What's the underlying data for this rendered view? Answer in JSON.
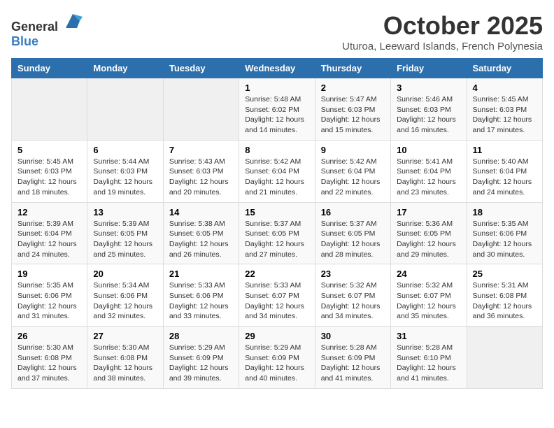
{
  "header": {
    "logo_general": "General",
    "logo_blue": "Blue",
    "month_title": "October 2025",
    "location": "Uturoa, Leeward Islands, French Polynesia"
  },
  "days_of_week": [
    "Sunday",
    "Monday",
    "Tuesday",
    "Wednesday",
    "Thursday",
    "Friday",
    "Saturday"
  ],
  "weeks": [
    [
      {
        "day": "",
        "info": ""
      },
      {
        "day": "",
        "info": ""
      },
      {
        "day": "",
        "info": ""
      },
      {
        "day": "1",
        "sunrise": "Sunrise: 5:48 AM",
        "sunset": "Sunset: 6:02 PM",
        "daylight": "Daylight: 12 hours and 14 minutes."
      },
      {
        "day": "2",
        "sunrise": "Sunrise: 5:47 AM",
        "sunset": "Sunset: 6:03 PM",
        "daylight": "Daylight: 12 hours and 15 minutes."
      },
      {
        "day": "3",
        "sunrise": "Sunrise: 5:46 AM",
        "sunset": "Sunset: 6:03 PM",
        "daylight": "Daylight: 12 hours and 16 minutes."
      },
      {
        "day": "4",
        "sunrise": "Sunrise: 5:45 AM",
        "sunset": "Sunset: 6:03 PM",
        "daylight": "Daylight: 12 hours and 17 minutes."
      }
    ],
    [
      {
        "day": "5",
        "sunrise": "Sunrise: 5:45 AM",
        "sunset": "Sunset: 6:03 PM",
        "daylight": "Daylight: 12 hours and 18 minutes."
      },
      {
        "day": "6",
        "sunrise": "Sunrise: 5:44 AM",
        "sunset": "Sunset: 6:03 PM",
        "daylight": "Daylight: 12 hours and 19 minutes."
      },
      {
        "day": "7",
        "sunrise": "Sunrise: 5:43 AM",
        "sunset": "Sunset: 6:03 PM",
        "daylight": "Daylight: 12 hours and 20 minutes."
      },
      {
        "day": "8",
        "sunrise": "Sunrise: 5:42 AM",
        "sunset": "Sunset: 6:04 PM",
        "daylight": "Daylight: 12 hours and 21 minutes."
      },
      {
        "day": "9",
        "sunrise": "Sunrise: 5:42 AM",
        "sunset": "Sunset: 6:04 PM",
        "daylight": "Daylight: 12 hours and 22 minutes."
      },
      {
        "day": "10",
        "sunrise": "Sunrise: 5:41 AM",
        "sunset": "Sunset: 6:04 PM",
        "daylight": "Daylight: 12 hours and 23 minutes."
      },
      {
        "day": "11",
        "sunrise": "Sunrise: 5:40 AM",
        "sunset": "Sunset: 6:04 PM",
        "daylight": "Daylight: 12 hours and 24 minutes."
      }
    ],
    [
      {
        "day": "12",
        "sunrise": "Sunrise: 5:39 AM",
        "sunset": "Sunset: 6:04 PM",
        "daylight": "Daylight: 12 hours and 24 minutes."
      },
      {
        "day": "13",
        "sunrise": "Sunrise: 5:39 AM",
        "sunset": "Sunset: 6:05 PM",
        "daylight": "Daylight: 12 hours and 25 minutes."
      },
      {
        "day": "14",
        "sunrise": "Sunrise: 5:38 AM",
        "sunset": "Sunset: 6:05 PM",
        "daylight": "Daylight: 12 hours and 26 minutes."
      },
      {
        "day": "15",
        "sunrise": "Sunrise: 5:37 AM",
        "sunset": "Sunset: 6:05 PM",
        "daylight": "Daylight: 12 hours and 27 minutes."
      },
      {
        "day": "16",
        "sunrise": "Sunrise: 5:37 AM",
        "sunset": "Sunset: 6:05 PM",
        "daylight": "Daylight: 12 hours and 28 minutes."
      },
      {
        "day": "17",
        "sunrise": "Sunrise: 5:36 AM",
        "sunset": "Sunset: 6:05 PM",
        "daylight": "Daylight: 12 hours and 29 minutes."
      },
      {
        "day": "18",
        "sunrise": "Sunrise: 5:35 AM",
        "sunset": "Sunset: 6:06 PM",
        "daylight": "Daylight: 12 hours and 30 minutes."
      }
    ],
    [
      {
        "day": "19",
        "sunrise": "Sunrise: 5:35 AM",
        "sunset": "Sunset: 6:06 PM",
        "daylight": "Daylight: 12 hours and 31 minutes."
      },
      {
        "day": "20",
        "sunrise": "Sunrise: 5:34 AM",
        "sunset": "Sunset: 6:06 PM",
        "daylight": "Daylight: 12 hours and 32 minutes."
      },
      {
        "day": "21",
        "sunrise": "Sunrise: 5:33 AM",
        "sunset": "Sunset: 6:06 PM",
        "daylight": "Daylight: 12 hours and 33 minutes."
      },
      {
        "day": "22",
        "sunrise": "Sunrise: 5:33 AM",
        "sunset": "Sunset: 6:07 PM",
        "daylight": "Daylight: 12 hours and 34 minutes."
      },
      {
        "day": "23",
        "sunrise": "Sunrise: 5:32 AM",
        "sunset": "Sunset: 6:07 PM",
        "daylight": "Daylight: 12 hours and 34 minutes."
      },
      {
        "day": "24",
        "sunrise": "Sunrise: 5:32 AM",
        "sunset": "Sunset: 6:07 PM",
        "daylight": "Daylight: 12 hours and 35 minutes."
      },
      {
        "day": "25",
        "sunrise": "Sunrise: 5:31 AM",
        "sunset": "Sunset: 6:08 PM",
        "daylight": "Daylight: 12 hours and 36 minutes."
      }
    ],
    [
      {
        "day": "26",
        "sunrise": "Sunrise: 5:30 AM",
        "sunset": "Sunset: 6:08 PM",
        "daylight": "Daylight: 12 hours and 37 minutes."
      },
      {
        "day": "27",
        "sunrise": "Sunrise: 5:30 AM",
        "sunset": "Sunset: 6:08 PM",
        "daylight": "Daylight: 12 hours and 38 minutes."
      },
      {
        "day": "28",
        "sunrise": "Sunrise: 5:29 AM",
        "sunset": "Sunset: 6:09 PM",
        "daylight": "Daylight: 12 hours and 39 minutes."
      },
      {
        "day": "29",
        "sunrise": "Sunrise: 5:29 AM",
        "sunset": "Sunset: 6:09 PM",
        "daylight": "Daylight: 12 hours and 40 minutes."
      },
      {
        "day": "30",
        "sunrise": "Sunrise: 5:28 AM",
        "sunset": "Sunset: 6:09 PM",
        "daylight": "Daylight: 12 hours and 41 minutes."
      },
      {
        "day": "31",
        "sunrise": "Sunrise: 5:28 AM",
        "sunset": "Sunset: 6:10 PM",
        "daylight": "Daylight: 12 hours and 41 minutes."
      },
      {
        "day": "",
        "info": ""
      }
    ]
  ]
}
